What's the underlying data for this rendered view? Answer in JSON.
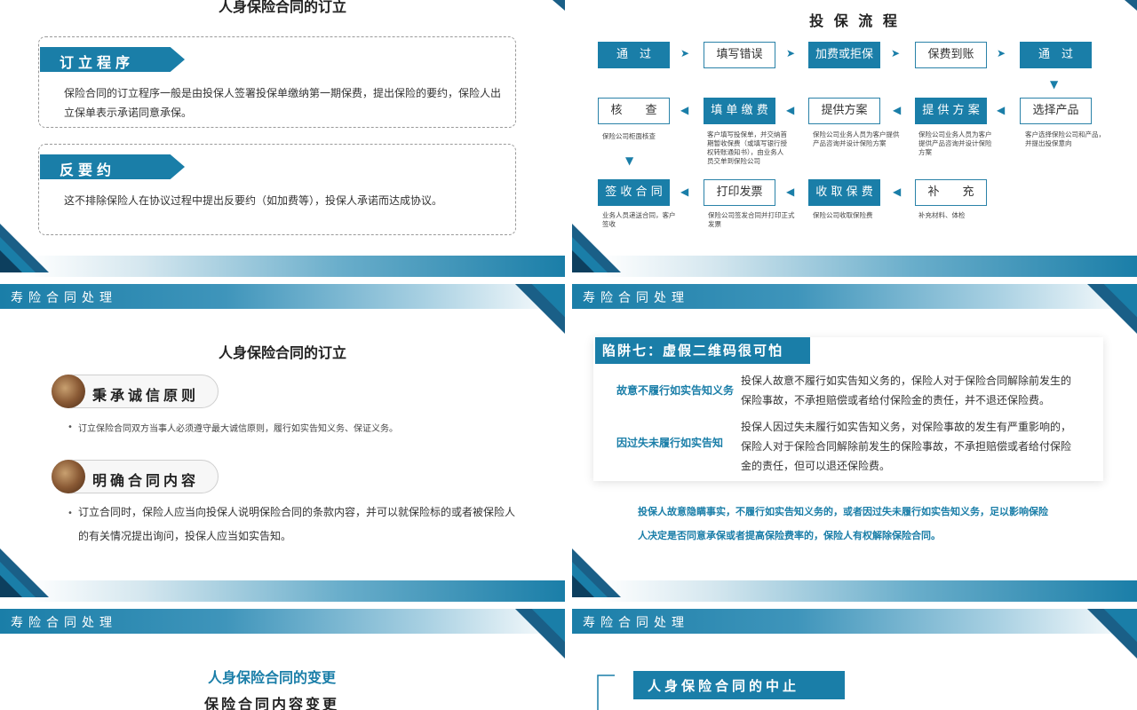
{
  "slide1": {
    "title": "人身保险合同的订立",
    "box1": {
      "tag": "订立程序",
      "text1": "保险合同的订立程序一般是由投保人签署投保单缴纳第一期保费，提出保险的要约，保险人出",
      "text2": "立保单表示承诺同意承保。"
    },
    "box2": {
      "tag": "反要约",
      "text": "这不排除保险人在协议过程中提出反要约（如加费等），投保人承诺而达成协议。"
    }
  },
  "slide2": {
    "title": "投 保 流 程",
    "row1": [
      "通　过",
      "填写错误",
      "加费或拒保",
      "保费到账",
      "通　过"
    ],
    "row2": [
      "核　　查",
      "填 单 缴 费",
      "提供方案",
      "提 供 方 案",
      "选择产品"
    ],
    "row2_desc": [
      "保险公司柜面核查",
      "客户填写投保单，并交纳首期暂收保费（或填写银行授权转账通知书），由业务人员交单到保险公司",
      "保险公司业务人员为客户提供产品咨询并设计保险方案",
      "保险公司业务人员为客户提供产品咨询并设计保险方案",
      "客户选择保险公司和产品，并提出投保意向"
    ],
    "row3": [
      "签 收 合 同",
      "打印发票",
      "收 取 保 费",
      "补　　充"
    ],
    "row3_desc": [
      "业务人员递送合同，客户签收",
      "保险公司签发合同并打印正式发票",
      "保险公司收取保险费",
      "补充材料、体检"
    ]
  },
  "slide3": {
    "header": "寿险合同处理",
    "title": "人身保险合同的订立",
    "item1": {
      "label": "秉承诚信原则",
      "bullet": "订立保险合同双方当事人必须遵守最大诚信原则，履行如实告知义务、保证义务。"
    },
    "item2": {
      "label": "明确合同内容",
      "bullet1": "订立合同时，保险人应当向投保人说明保险合同的条款内容，并可以就保险标的或者被保险人",
      "bullet2": "的有关情况提出询问，投保人应当如实告知。"
    }
  },
  "slide4": {
    "header": "寿险合同处理",
    "card_title": "陷阱七：虚假二维码很可怕",
    "row1": {
      "label": "故意不履行如实告知义务",
      "text1": "投保人故意不履行如实告知义务的，保险人对于保险合同解除前发生的",
      "text2": "保险事故，不承担赔偿或者给付保险金的责任，并不退还保险费。"
    },
    "row2": {
      "label": "因过失未履行如实告知",
      "text1": "投保人因过失未履行如实告知义务，对保险事故的发生有严重影响的，",
      "text2": "保险人对于保险合同解除前发生的保险事故，不承担赔偿或者给付保险",
      "text3": "金的责任，但可以退还保险费。"
    },
    "footer1": "投保人故意隐瞒事实，不履行如实告知义务的，或者因过失未履行如实告知义务，足以影响保险",
    "footer2": "人决定是否同意承保或者提高保险费率的，保险人有权解除保险合同。"
  },
  "slide5": {
    "header": "寿险合同处理",
    "title": "人身保险合同的变更",
    "subtitle": "保险合同内容变更"
  },
  "slide6": {
    "header": "寿险合同处理",
    "tag": "人身保险合同的中止"
  }
}
